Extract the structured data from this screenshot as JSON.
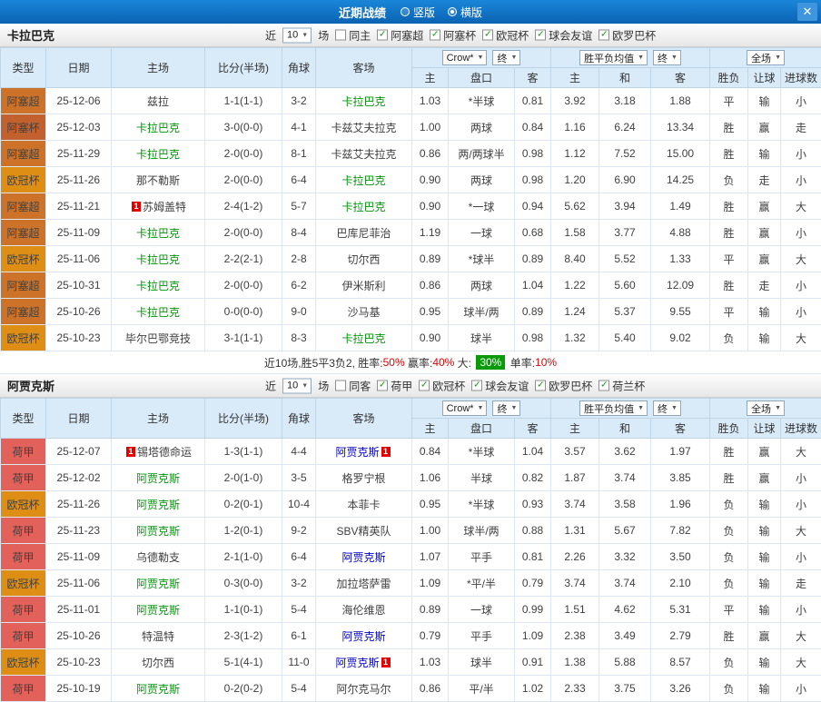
{
  "topbar": {
    "title": "近期战绩",
    "close_icon": "✕",
    "view_options": [
      {
        "label": "竖版",
        "selected": false
      },
      {
        "label": "横版",
        "selected": true
      }
    ]
  },
  "table_header": {
    "main_cols": [
      "类型",
      "日期",
      "主场",
      "比分(半场)",
      "角球",
      "客场"
    ],
    "sub_cols": [
      "主",
      "盘口",
      "客",
      "主",
      "和",
      "客",
      "胜负",
      "让球",
      "进球数"
    ],
    "odds_controls": [
      "Crow*",
      "终"
    ],
    "avg_controls": [
      "胜平负均值",
      "终"
    ],
    "outcome_controls": [
      "全场"
    ]
  },
  "league_colors": {
    "阿塞超": "#cd7329",
    "阿塞杯": "#c3612e",
    "欧冠杯": "#de8e14",
    "荷甲": "#e2625b"
  },
  "sections": [
    {
      "team": "卡拉巴克",
      "filter": {
        "prefix": "近",
        "count": "10",
        "suffix": "场",
        "venue": {
          "label": "同主",
          "checked": false
        },
        "leagues": [
          {
            "label": "阿塞超",
            "checked": true
          },
          {
            "label": "阿塞杯",
            "checked": true
          },
          {
            "label": "欧冠杯",
            "checked": true
          },
          {
            "label": "球会友谊",
            "checked": true
          },
          {
            "label": "欧罗巴杯",
            "checked": true
          }
        ]
      },
      "rows": [
        {
          "league": "阿塞超",
          "date": "25-12-06",
          "home": {
            "name": "兹拉"
          },
          "score": "1-1(1-1)",
          "score_color": "blue",
          "corner": "3-2",
          "away": {
            "name": "卡拉巴克",
            "hl": "green"
          },
          "h_home": "1.03",
          "line": "*半球",
          "h_away": "0.81",
          "avg_home": "3.92",
          "avg_draw": "3.18",
          "avg_away": "1.88",
          "wdl": "平",
          "wdl_color": "blue",
          "cover": "输",
          "cover_color": "green",
          "goals": "小",
          "goals_color": "green"
        },
        {
          "league": "阿塞杯",
          "date": "25-12-03",
          "home": {
            "name": "卡拉巴克",
            "hl": "green"
          },
          "score": "3-0(0-0)",
          "score_color": "red",
          "corner": "4-1",
          "away": {
            "name": "卡兹艾夫拉克"
          },
          "h_home": "1.00",
          "line": "两球",
          "h_away": "0.84",
          "avg_home": "1.16",
          "avg_draw": "6.24",
          "avg_away": "13.34",
          "wdl": "胜",
          "wdl_color": "red",
          "cover": "赢",
          "cover_color": "red",
          "goals": "走",
          "goals_color": "blue"
        },
        {
          "league": "阿塞超",
          "date": "25-11-29",
          "home": {
            "name": "卡拉巴克",
            "hl": "green"
          },
          "score": "2-0(0-0)",
          "score_color": "red",
          "corner": "8-1",
          "away": {
            "name": "卡兹艾夫拉克"
          },
          "h_home": "0.86",
          "line": "两/两球半",
          "h_away": "0.98",
          "avg_home": "1.12",
          "avg_draw": "7.52",
          "avg_away": "15.00",
          "wdl": "胜",
          "wdl_color": "red",
          "cover": "输",
          "cover_color": "green",
          "goals": "小",
          "goals_color": "green"
        },
        {
          "league": "欧冠杯",
          "date": "25-11-26",
          "home": {
            "name": "那不勒斯"
          },
          "score": "2-0(0-0)",
          "score_color": "red",
          "corner": "6-4",
          "away": {
            "name": "卡拉巴克",
            "hl": "green"
          },
          "h_home": "0.90",
          "line": "两球",
          "h_away": "0.98",
          "avg_home": "1.20",
          "avg_draw": "6.90",
          "avg_away": "14.25",
          "wdl": "负",
          "wdl_color": "green",
          "cover": "走",
          "cover_color": "blue",
          "goals": "小",
          "goals_color": "green"
        },
        {
          "league": "阿塞超",
          "date": "25-11-21",
          "home": {
            "name": "苏姆盖特",
            "badge": "1",
            "badge_side": "left"
          },
          "score": "2-4(1-2)",
          "score_color": "blue",
          "corner": "5-7",
          "away": {
            "name": "卡拉巴克",
            "hl": "green"
          },
          "h_home": "0.90",
          "line": "*一球",
          "h_away": "0.94",
          "avg_home": "5.62",
          "avg_draw": "3.94",
          "avg_away": "1.49",
          "wdl": "胜",
          "wdl_color": "red",
          "cover": "赢",
          "cover_color": "red",
          "goals": "大",
          "goals_color": "red"
        },
        {
          "league": "阿塞超",
          "date": "25-11-09",
          "home": {
            "name": "卡拉巴克",
            "hl": "green"
          },
          "score": "2-0(0-0)",
          "score_color": "red",
          "corner": "8-4",
          "away": {
            "name": "巴库尼菲治"
          },
          "h_home": "1.19",
          "line": "一球",
          "h_away": "0.68",
          "avg_home": "1.58",
          "avg_draw": "3.77",
          "avg_away": "4.88",
          "wdl": "胜",
          "wdl_color": "red",
          "cover": "赢",
          "cover_color": "red",
          "goals": "小",
          "goals_color": "green"
        },
        {
          "league": "欧冠杯",
          "date": "25-11-06",
          "home": {
            "name": "卡拉巴克",
            "hl": "green"
          },
          "score": "2-2(2-1)",
          "score_color": "blue",
          "corner": "2-8",
          "away": {
            "name": "切尔西"
          },
          "h_home": "0.89",
          "line": "*球半",
          "h_away": "0.89",
          "avg_home": "8.40",
          "avg_draw": "5.52",
          "avg_away": "1.33",
          "wdl": "平",
          "wdl_color": "blue",
          "cover": "赢",
          "cover_color": "red",
          "goals": "大",
          "goals_color": "red"
        },
        {
          "league": "阿塞超",
          "date": "25-10-31",
          "home": {
            "name": "卡拉巴克",
            "hl": "green"
          },
          "score": "2-0(0-0)",
          "score_color": "red",
          "corner": "6-2",
          "away": {
            "name": "伊米斯利"
          },
          "h_home": "0.86",
          "line": "两球",
          "h_away": "1.04",
          "avg_home": "1.22",
          "avg_draw": "5.60",
          "avg_away": "12.09",
          "wdl": "胜",
          "wdl_color": "red",
          "cover": "走",
          "cover_color": "blue",
          "goals": "小",
          "goals_color": "green"
        },
        {
          "league": "阿塞超",
          "date": "25-10-26",
          "home": {
            "name": "卡拉巴克",
            "hl": "green"
          },
          "score": "0-0(0-0)",
          "score_color": "blue",
          "corner": "9-0",
          "away": {
            "name": "沙马基"
          },
          "h_home": "0.95",
          "line": "球半/两",
          "h_away": "0.89",
          "avg_home": "1.24",
          "avg_draw": "5.37",
          "avg_away": "9.55",
          "wdl": "平",
          "wdl_color": "blue",
          "cover": "输",
          "cover_color": "green",
          "goals": "小",
          "goals_color": "green"
        },
        {
          "league": "欧冠杯",
          "date": "25-10-23",
          "home": {
            "name": "毕尔巴鄂竞技"
          },
          "score": "3-1(1-1)",
          "score_color": "red",
          "corner": "8-3",
          "away": {
            "name": "卡拉巴克",
            "hl": "green"
          },
          "h_home": "0.90",
          "line": "球半",
          "h_away": "0.98",
          "avg_home": "1.32",
          "avg_draw": "5.40",
          "avg_away": "9.02",
          "wdl": "负",
          "wdl_color": "green",
          "cover": "输",
          "cover_color": "green",
          "goals": "大",
          "goals_color": "red"
        }
      ],
      "summary": [
        {
          "text": "近10场,胜5平3负2,",
          "style": "plain"
        },
        {
          "text": " 胜率:",
          "style": "plain"
        },
        {
          "text": "50%",
          "style": "red"
        },
        {
          "text": " 赢率:",
          "style": "plain"
        },
        {
          "text": "40%",
          "style": "red"
        },
        {
          "text": " 大: ",
          "style": "plain"
        },
        {
          "text": "30%",
          "style": "green-badge"
        },
        {
          "text": " 单率:",
          "style": "plain"
        },
        {
          "text": "10%",
          "style": "red"
        }
      ]
    },
    {
      "team": "阿贾克斯",
      "filter": {
        "prefix": "近",
        "count": "10",
        "suffix": "场",
        "venue": {
          "label": "同客",
          "checked": false
        },
        "leagues": [
          {
            "label": "荷甲",
            "checked": true
          },
          {
            "label": "欧冠杯",
            "checked": true
          },
          {
            "label": "球会友谊",
            "checked": true
          },
          {
            "label": "欧罗巴杯",
            "checked": true
          },
          {
            "label": "荷兰杯",
            "checked": true
          }
        ]
      },
      "rows": [
        {
          "league": "荷甲",
          "date": "25-12-07",
          "home": {
            "name": "锡塔德命运",
            "badge": "1",
            "badge_side": "left"
          },
          "score": "1-3(1-1)",
          "score_color": "blue",
          "corner": "4-4",
          "away": {
            "name": "阿贾克斯",
            "hl": "blue",
            "badge": "1",
            "badge_side": "right"
          },
          "h_home": "0.84",
          "line": "*半球",
          "h_away": "1.04",
          "avg_home": "3.57",
          "avg_draw": "3.62",
          "avg_away": "1.97",
          "wdl": "胜",
          "wdl_color": "red",
          "cover": "赢",
          "cover_color": "red",
          "goals": "大",
          "goals_color": "red"
        },
        {
          "league": "荷甲",
          "date": "25-12-02",
          "home": {
            "name": "阿贾克斯",
            "hl": "green"
          },
          "score": "2-0(1-0)",
          "score_color": "red",
          "corner": "3-5",
          "away": {
            "name": "格罗宁根"
          },
          "h_home": "1.06",
          "line": "半球",
          "h_away": "0.82",
          "avg_home": "1.87",
          "avg_draw": "3.74",
          "avg_away": "3.85",
          "wdl": "胜",
          "wdl_color": "red",
          "cover": "赢",
          "cover_color": "red",
          "goals": "小",
          "goals_color": "green"
        },
        {
          "league": "欧冠杯",
          "date": "25-11-26",
          "home": {
            "name": "阿贾克斯",
            "hl": "green"
          },
          "score": "0-2(0-1)",
          "score_color": "blue",
          "corner": "10-4",
          "away": {
            "name": "本菲卡"
          },
          "h_home": "0.95",
          "line": "*半球",
          "h_away": "0.93",
          "avg_home": "3.74",
          "avg_draw": "3.58",
          "avg_away": "1.96",
          "wdl": "负",
          "wdl_color": "green",
          "cover": "输",
          "cover_color": "green",
          "goals": "小",
          "goals_color": "green"
        },
        {
          "league": "荷甲",
          "date": "25-11-23",
          "home": {
            "name": "阿贾克斯",
            "hl": "green"
          },
          "score": "1-2(0-1)",
          "score_color": "blue",
          "corner": "9-2",
          "away": {
            "name": "SBV精英队"
          },
          "h_home": "1.00",
          "line": "球半/两",
          "h_away": "0.88",
          "avg_home": "1.31",
          "avg_draw": "5.67",
          "avg_away": "7.82",
          "wdl": "负",
          "wdl_color": "green",
          "cover": "输",
          "cover_color": "green",
          "goals": "大",
          "goals_color": "red"
        },
        {
          "league": "荷甲",
          "date": "25-11-09",
          "home": {
            "name": "乌德勒支"
          },
          "score": "2-1(1-0)",
          "score_color": "red",
          "corner": "6-4",
          "away": {
            "name": "阿贾克斯",
            "hl": "blue"
          },
          "h_home": "1.07",
          "line": "平手",
          "h_away": "0.81",
          "avg_home": "2.26",
          "avg_draw": "3.32",
          "avg_away": "3.50",
          "wdl": "负",
          "wdl_color": "green",
          "cover": "输",
          "cover_color": "green",
          "goals": "小",
          "goals_color": "green"
        },
        {
          "league": "欧冠杯",
          "date": "25-11-06",
          "home": {
            "name": "阿贾克斯",
            "hl": "green"
          },
          "score": "0-3(0-0)",
          "score_color": "blue",
          "corner": "3-2",
          "away": {
            "name": "加拉塔萨雷"
          },
          "h_home": "1.09",
          "line": "*平/半",
          "h_away": "0.79",
          "avg_home": "3.74",
          "avg_draw": "3.74",
          "avg_away": "2.10",
          "wdl": "负",
          "wdl_color": "green",
          "cover": "输",
          "cover_color": "green",
          "goals": "走",
          "goals_color": "blue"
        },
        {
          "league": "荷甲",
          "date": "25-11-01",
          "home": {
            "name": "阿贾克斯",
            "hl": "green"
          },
          "score": "1-1(0-1)",
          "score_color": "blue",
          "corner": "5-4",
          "away": {
            "name": "海伦维恩"
          },
          "h_home": "0.89",
          "line": "一球",
          "h_away": "0.99",
          "avg_home": "1.51",
          "avg_draw": "4.62",
          "avg_away": "5.31",
          "wdl": "平",
          "wdl_color": "blue",
          "cover": "输",
          "cover_color": "green",
          "goals": "小",
          "goals_color": "green"
        },
        {
          "league": "荷甲",
          "date": "25-10-26",
          "home": {
            "name": "特温特"
          },
          "score": "2-3(1-2)",
          "score_color": "blue",
          "corner": "6-1",
          "away": {
            "name": "阿贾克斯",
            "hl": "blue"
          },
          "h_home": "0.79",
          "line": "平手",
          "h_away": "1.09",
          "avg_home": "2.38",
          "avg_draw": "3.49",
          "avg_away": "2.79",
          "wdl": "胜",
          "wdl_color": "red",
          "cover": "赢",
          "cover_color": "red",
          "goals": "大",
          "goals_color": "red"
        },
        {
          "league": "欧冠杯",
          "date": "25-10-23",
          "home": {
            "name": "切尔西"
          },
          "score": "5-1(4-1)",
          "score_color": "red",
          "corner": "11-0",
          "away": {
            "name": "阿贾克斯",
            "hl": "blue",
            "badge": "1",
            "badge_side": "right"
          },
          "h_home": "1.03",
          "line": "球半",
          "h_away": "0.91",
          "avg_home": "1.38",
          "avg_draw": "5.88",
          "avg_away": "8.57",
          "wdl": "负",
          "wdl_color": "green",
          "cover": "输",
          "cover_color": "green",
          "goals": "大",
          "goals_color": "red"
        },
        {
          "league": "荷甲",
          "date": "25-10-19",
          "home": {
            "name": "阿贾克斯",
            "hl": "green"
          },
          "score": "0-2(0-2)",
          "score_color": "blue",
          "corner": "5-4",
          "away": {
            "name": "阿尔克马尔"
          },
          "h_home": "0.86",
          "line": "平/半",
          "h_away": "1.02",
          "avg_home": "2.33",
          "avg_draw": "3.75",
          "avg_away": "3.26",
          "wdl": "负",
          "wdl_color": "green",
          "cover": "输",
          "cover_color": "green",
          "goals": "小",
          "goals_color": "green"
        }
      ],
      "summary": null
    }
  ]
}
